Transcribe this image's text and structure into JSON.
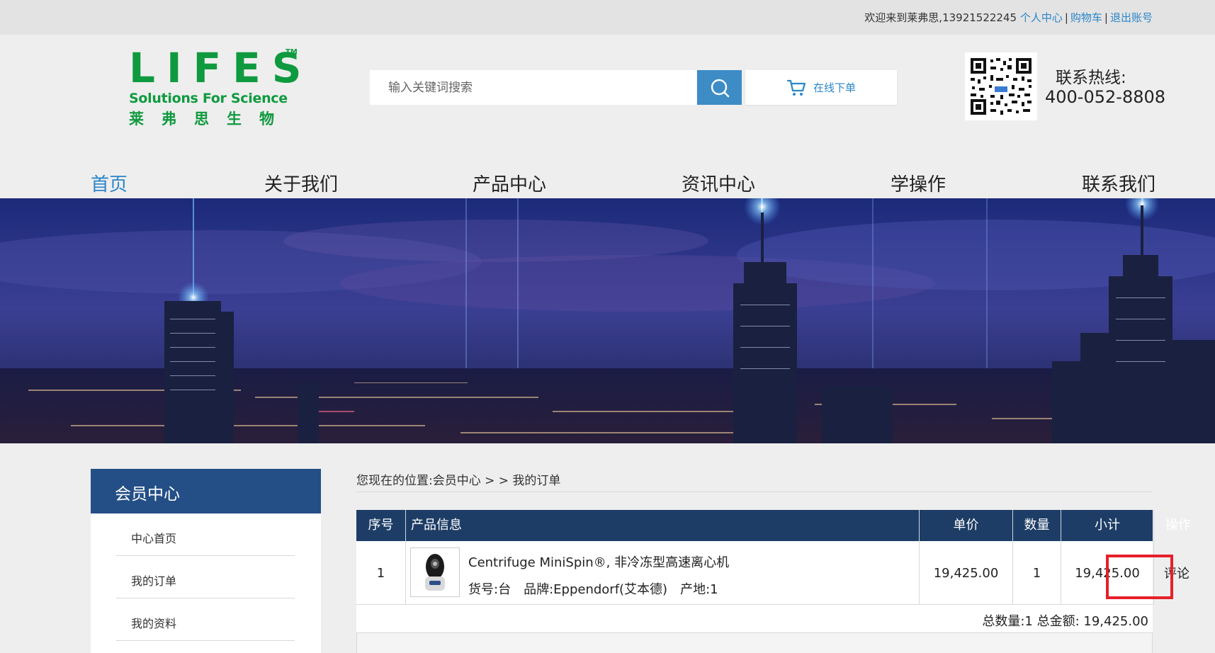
{
  "topbar": {
    "welcome": "欢迎来到莱弗思,13921522245",
    "links": [
      "个人中心",
      "购物车",
      "退出账号"
    ],
    "separator": "|"
  },
  "logo": {
    "brand": "LIFES",
    "tm": "TM",
    "tagline": "Solutions For Science",
    "cn": "莱弗思生物"
  },
  "search": {
    "placeholder": "输入关键词搜索"
  },
  "order_button": {
    "label": "在线下单"
  },
  "contact": {
    "label": "联系热线:",
    "phone": "400-052-8808"
  },
  "nav": {
    "items": [
      "首页",
      "关于我们",
      "产品中心",
      "资讯中心",
      "学操作",
      "联系我们"
    ],
    "active": "首页"
  },
  "sidebar": {
    "title": "会员中心",
    "items": [
      "中心首页",
      "我的订单",
      "我的资料"
    ]
  },
  "breadcrumb": {
    "prefix": "您现在的位置:",
    "path": "会员中心 > > 我的订单"
  },
  "order_table": {
    "headers": [
      "序号",
      "产品信息",
      "单价",
      "数量",
      "小计",
      "操作"
    ],
    "rows": [
      {
        "index": "1",
        "product_name": "Centrifuge MiniSpin®, 非冷冻型高速离心机",
        "item_no": "货号:台",
        "brand": "品牌:Eppendorf(艾本德)",
        "origin": "产地:1",
        "unit_price": "19,425.00",
        "quantity": "1",
        "subtotal": "19,425.00",
        "action": "评论"
      }
    ],
    "totals": "总数量:1  总金额:  19,425.00"
  },
  "colors": {
    "accent": "#2a86c9",
    "brand_green": "#0f9a3f",
    "table_header": "#1d3d66",
    "sidebar_header": "#244f86",
    "highlight": "#e6202a"
  },
  "icons": [
    "search-icon",
    "cart-icon",
    "qr-code"
  ]
}
